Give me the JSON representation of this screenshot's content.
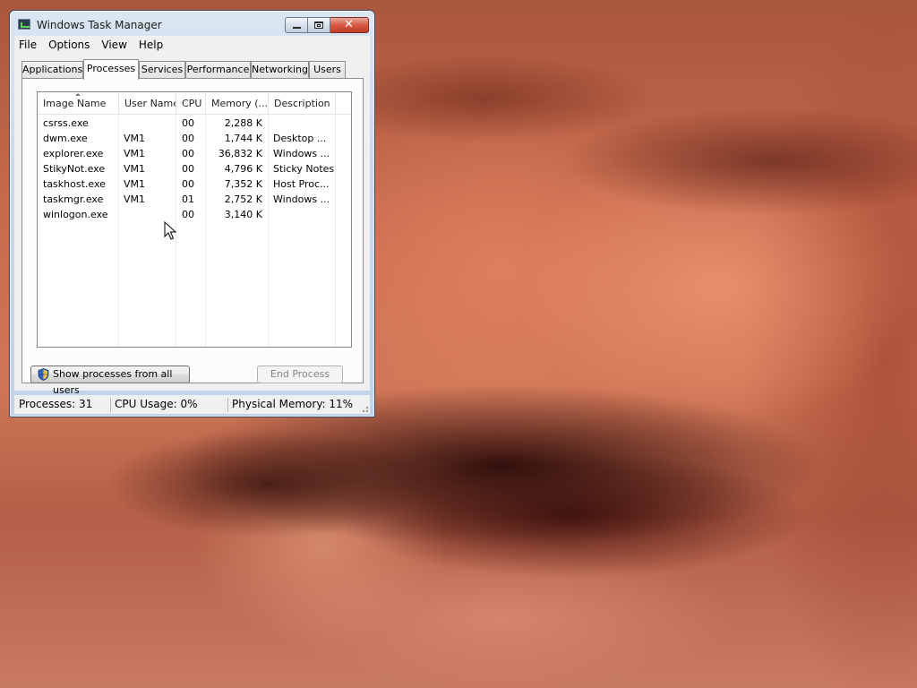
{
  "window": {
    "title": "Windows Task Manager"
  },
  "menu": [
    "File",
    "Options",
    "View",
    "Help"
  ],
  "tabs": [
    "Applications",
    "Processes",
    "Services",
    "Performance",
    "Networking",
    "Users"
  ],
  "active_tab": "Processes",
  "columns": [
    "Image Name",
    "User Name",
    "CPU",
    "Memory (...",
    "Description"
  ],
  "processes": [
    {
      "image": "csrss.exe",
      "user": "",
      "cpu": "00",
      "memory": "2,288 K",
      "description": ""
    },
    {
      "image": "dwm.exe",
      "user": "VM1",
      "cpu": "00",
      "memory": "1,744 K",
      "description": "Desktop ..."
    },
    {
      "image": "explorer.exe",
      "user": "VM1",
      "cpu": "00",
      "memory": "36,832 K",
      "description": "Windows ..."
    },
    {
      "image": "StikyNot.exe",
      "user": "VM1",
      "cpu": "00",
      "memory": "4,796 K",
      "description": "Sticky Notes"
    },
    {
      "image": "taskhost.exe",
      "user": "VM1",
      "cpu": "00",
      "memory": "7,352 K",
      "description": "Host Proc..."
    },
    {
      "image": "taskmgr.exe",
      "user": "VM1",
      "cpu": "01",
      "memory": "2,752 K",
      "description": "Windows ..."
    },
    {
      "image": "winlogon.exe",
      "user": "",
      "cpu": "00",
      "memory": "3,140 K",
      "description": ""
    }
  ],
  "buttons": {
    "show_all": "Show processes from all users",
    "end_process": "End Process"
  },
  "status": {
    "processes": "Processes: 31",
    "cpu": "CPU Usage: 0%",
    "memory": "Physical Memory: 11%"
  },
  "colors": {
    "close_button": "#c33d26",
    "frame": "#c2d3e8"
  }
}
